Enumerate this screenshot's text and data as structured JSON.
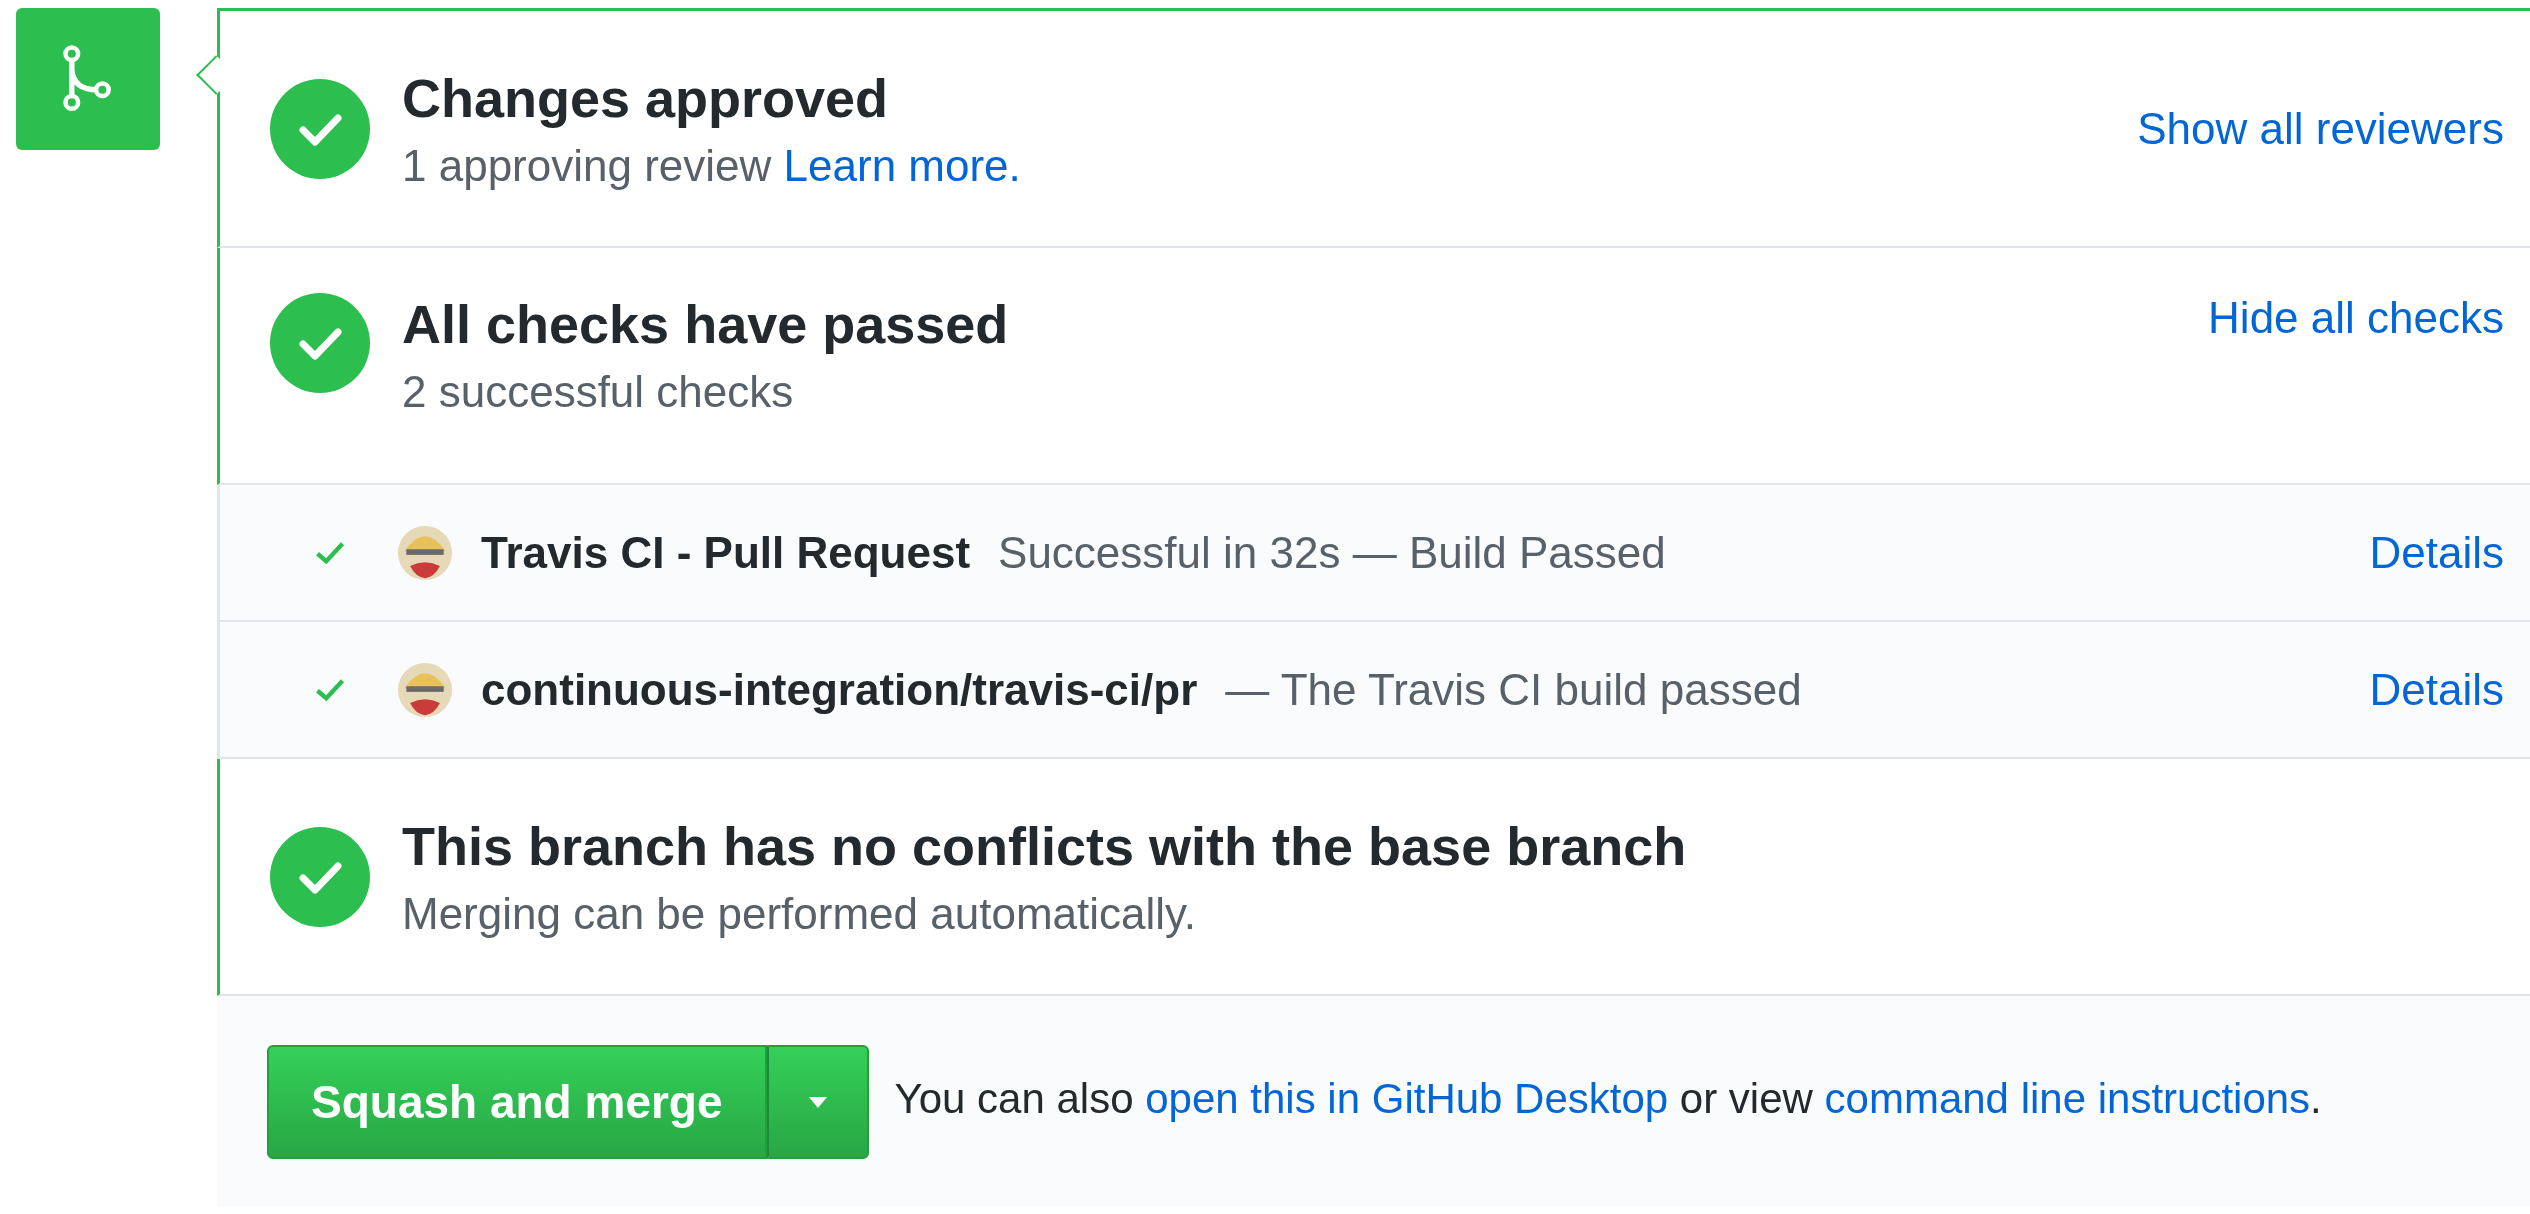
{
  "review": {
    "passed": true,
    "title": "Changes approved",
    "subtitle": [
      {
        "kind": "text",
        "text": "1 approving review"
      },
      {
        "kind": "link",
        "text": "Learn more."
      }
    ],
    "action": "Show all reviewers"
  },
  "checks": {
    "passed": true,
    "title": "All checks have passed",
    "subtitle": [
      {
        "kind": "text",
        "text": "2 successful checks"
      }
    ],
    "action": "Hide all checks",
    "items": [
      {
        "passed": true,
        "name": "Travis CI - Pull Request",
        "description": "Successful in 32s — Build Passed",
        "link": "Details"
      },
      {
        "passed": true,
        "name": "continuous-integration/travis-ci/pr",
        "description": "— The Travis CI build passed",
        "link": "Details"
      }
    ]
  },
  "conflicts": {
    "passed": true,
    "title": "This branch has no conflicts with the base branch",
    "subtitle": [
      {
        "kind": "text",
        "text": "Merging can be performed automatically."
      }
    ]
  },
  "merge": {
    "button": "Squash and merge",
    "note": [
      {
        "kind": "text",
        "text": "You can also"
      },
      {
        "kind": "link",
        "text": "open this in GitHub Desktop"
      },
      {
        "kind": "text",
        "text": "or view"
      },
      {
        "kind": "link",
        "text": "command line instructions"
      },
      {
        "kind": "text",
        "text": "."
      }
    ]
  }
}
